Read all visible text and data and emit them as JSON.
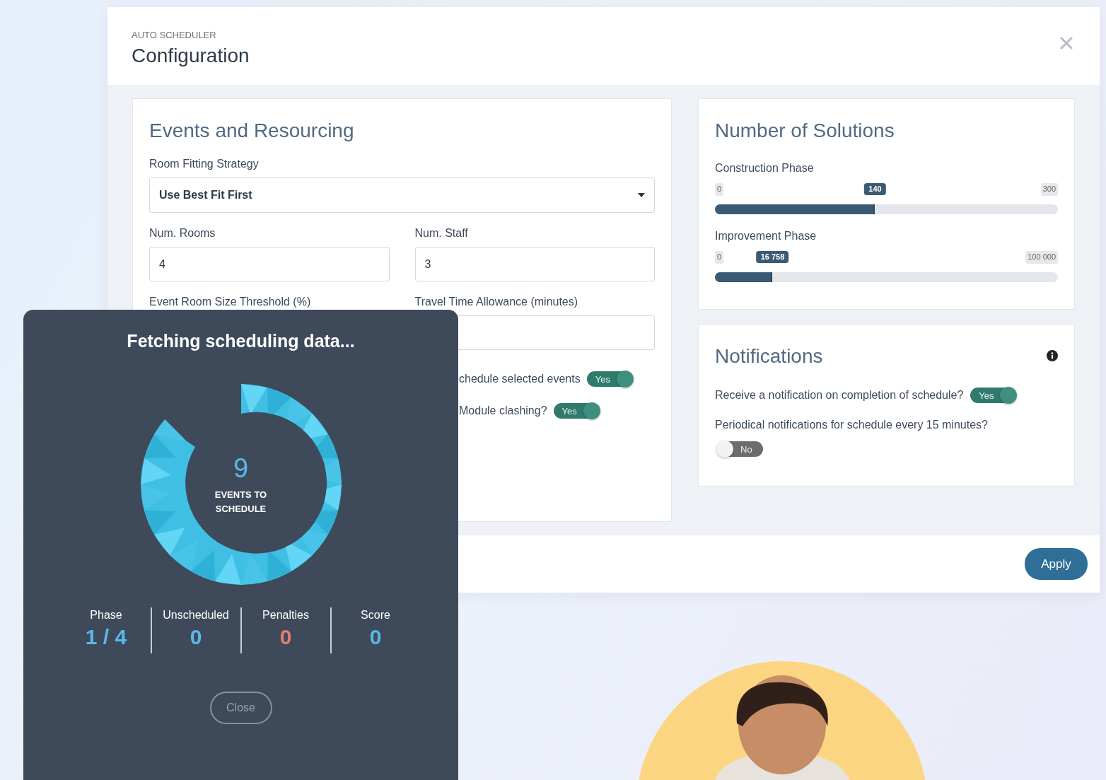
{
  "modal": {
    "eyebrow": "AUTO SCHEDULER",
    "title": "Configuration"
  },
  "events_card": {
    "title": "Events and Resourcing",
    "strategy": {
      "label": "Room Fitting Strategy",
      "value": "Use Best Fit First"
    },
    "num_rooms": {
      "label": "Num. Rooms",
      "value": "4"
    },
    "num_staff": {
      "label": "Num. Staff",
      "value": "3"
    },
    "threshold": {
      "label": "Event Room Size Threshold (%)"
    },
    "travel": {
      "label": "Travel Time Allowance (minutes)"
    },
    "toggles": [
      {
        "label": "chedule selected events",
        "on": true,
        "text": "Yes"
      },
      {
        "label": "Module clashing?",
        "on": true,
        "text": "Yes"
      }
    ]
  },
  "solutions_card": {
    "title": "Number of Solutions",
    "sliders": [
      {
        "label": "Construction Phase",
        "min": "0",
        "max": "300",
        "value": "140",
        "level": 0.467
      },
      {
        "label": "Improvement Phase",
        "min": "0",
        "max": "100 000",
        "value": "16 758",
        "level": 0.168
      }
    ]
  },
  "notifications_card": {
    "title": "Notifications",
    "toggles": [
      {
        "label": "Receive a notification on completion of schedule?",
        "on": true,
        "text": "Yes",
        "kind": "inline"
      },
      {
        "label": "Periodical notifications for schedule every 15 minutes?",
        "on": false,
        "text": "No",
        "kind": "stacked"
      }
    ]
  },
  "apply_button": "Apply",
  "progress_dialog": {
    "title": "Fetching scheduling data...",
    "count": "9",
    "count_label": "EVENTS TO SCHEDULE",
    "stats": [
      {
        "label": "Phase",
        "value": "1 / 4",
        "color": "#5bb8e8"
      },
      {
        "label": "Unscheduled",
        "value": "0",
        "color": "#5bb8e8"
      },
      {
        "label": "Penalties",
        "value": "0",
        "color": "#e27f6c"
      },
      {
        "label": "Score",
        "value": "0",
        "color": "#5bb8e8"
      }
    ],
    "close_button": "Close"
  }
}
